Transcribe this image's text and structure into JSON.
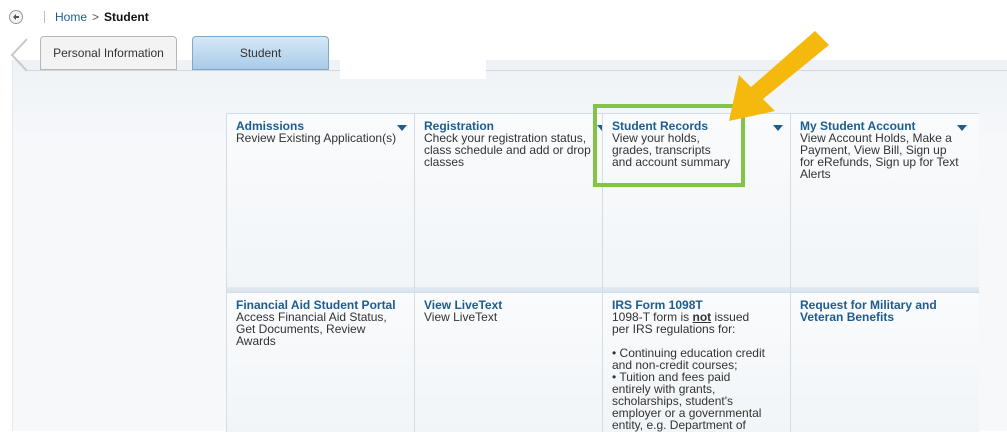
{
  "breadcrumb": {
    "home": "Home",
    "separator": ">",
    "current": "Student"
  },
  "tabs": [
    {
      "label": "Personal Information",
      "active": false
    },
    {
      "label": "Student",
      "active": true
    }
  ],
  "cards": [
    {
      "title": "Admissions",
      "desc": "Review Existing Application(s)",
      "has_menu": true
    },
    {
      "title": "Registration",
      "desc": "Check your registration status, class schedule and add or drop classes",
      "has_menu": true
    },
    {
      "title": "Student Records",
      "desc": "View your holds, grades, transcripts and account summary",
      "has_menu": true,
      "highlighted": true
    },
    {
      "title": "My Student Account",
      "desc": "View Account Holds, Make a Payment, View Bill, Sign up for eRefunds, Sign up for Text Alerts",
      "has_menu": true
    },
    {
      "title": "Financial Aid Student Portal",
      "desc": "Access Financial Aid Status, Get Documents, Review Awards"
    },
    {
      "title": "View LiveText",
      "desc": "View LiveText"
    },
    {
      "title": "IRS Form 1098T",
      "desc_before": "1098-T form is",
      "desc_emph": "not",
      "desc_after": "issued per IRS regulations for:",
      "bullets": [
        "• Continuing education credit and non-credit courses;",
        "• Tuition and fees paid entirely with grants, scholarships, student's employer or a governmental entity, e.g. Department of Veterans Affairs."
      ]
    },
    {
      "title": "Request for Military and Veteran Benefits",
      "desc": ""
    }
  ],
  "colors": {
    "link": "#1d5c8f",
    "highlight": "#84c444",
    "arrow": "#f5b90d"
  },
  "icons": {
    "back": "back-arrow-icon",
    "left_nav": "chevron-left-icon",
    "menu": "caret-down-icon"
  }
}
